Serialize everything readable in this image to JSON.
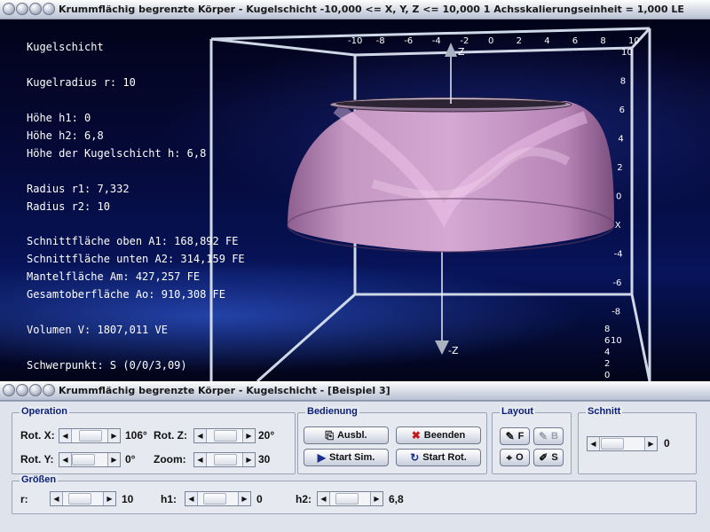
{
  "top_window": {
    "title": "Krummflächig begrenzte Körper - Kugelschicht   -10,000 <= X, Y, Z <= 10,000    1 Achsskalierungseinheit = 1,000 LE"
  },
  "info": {
    "heading": "Kugelschicht",
    "radius": "Kugelradius r: 10",
    "h1": "Höhe h1: 0",
    "h2": "Höhe h2: 6,8",
    "h": "Höhe der Kugelschicht h: 6,8",
    "r1": "Radius r1: 7,332",
    "r2": "Radius r2: 10",
    "a1": "Schnittfläche oben A1: 168,892 FE",
    "a2": "Schnittfläche unten A2: 314,159 FE",
    "am": "Mantelfläche Am: 427,257 FE",
    "ao": "Gesamtoberfläche Ao: 910,308 FE",
    "v": "Volumen V: 1807,011 VE",
    "s": "Schwerpunkt: S (0/0/3,09)"
  },
  "axes": {
    "x_ticks": [
      "-10",
      "-8",
      "-6",
      "-4",
      "-2",
      "0",
      "2",
      "4",
      "6",
      "8",
      "10"
    ],
    "right_ticks_top": [
      "10",
      "8",
      "6",
      "4",
      "2",
      "0",
      "X",
      "-4",
      "-6",
      "-8",
      "10"
    ],
    "right_ticks_bottom": [
      "8",
      "6",
      "4",
      "2",
      "0"
    ],
    "z_top": "Z",
    "z_bottom": "-Z"
  },
  "bottom_window": {
    "title": "Krummflächig begrenzte Körper - Kugelschicht - [Beispiel 3]"
  },
  "operation": {
    "legend": "Operation",
    "rot_x_label": "Rot. X:",
    "rot_x_value": "106°",
    "rot_y_label": "Rot. Y:",
    "rot_y_value": "0°",
    "rot_z_label": "Rot. Z:",
    "rot_z_value": "20°",
    "zoom_label": "Zoom:",
    "zoom_value": "30"
  },
  "bedienung": {
    "legend": "Bedienung",
    "ausbl": "Ausbl.",
    "beenden": "Beenden",
    "start_sim": "Start Sim.",
    "start_rot": "Start Rot."
  },
  "layout": {
    "legend": "Layout",
    "f": "F",
    "b": "B",
    "o": "O",
    "s": "S"
  },
  "schnitt": {
    "legend": "Schnitt",
    "value": "0"
  },
  "groessen": {
    "legend": "Größen",
    "r_label": "r:",
    "r_value": "10",
    "h1_label": "h1:",
    "h1_value": "0",
    "h2_label": "h2:",
    "h2_value": "6,8"
  },
  "colors": {
    "body": "#c993c4",
    "highlight": "#f3c8ef",
    "frame": "#cfd8e6",
    "panel": "#dfe3ec"
  }
}
